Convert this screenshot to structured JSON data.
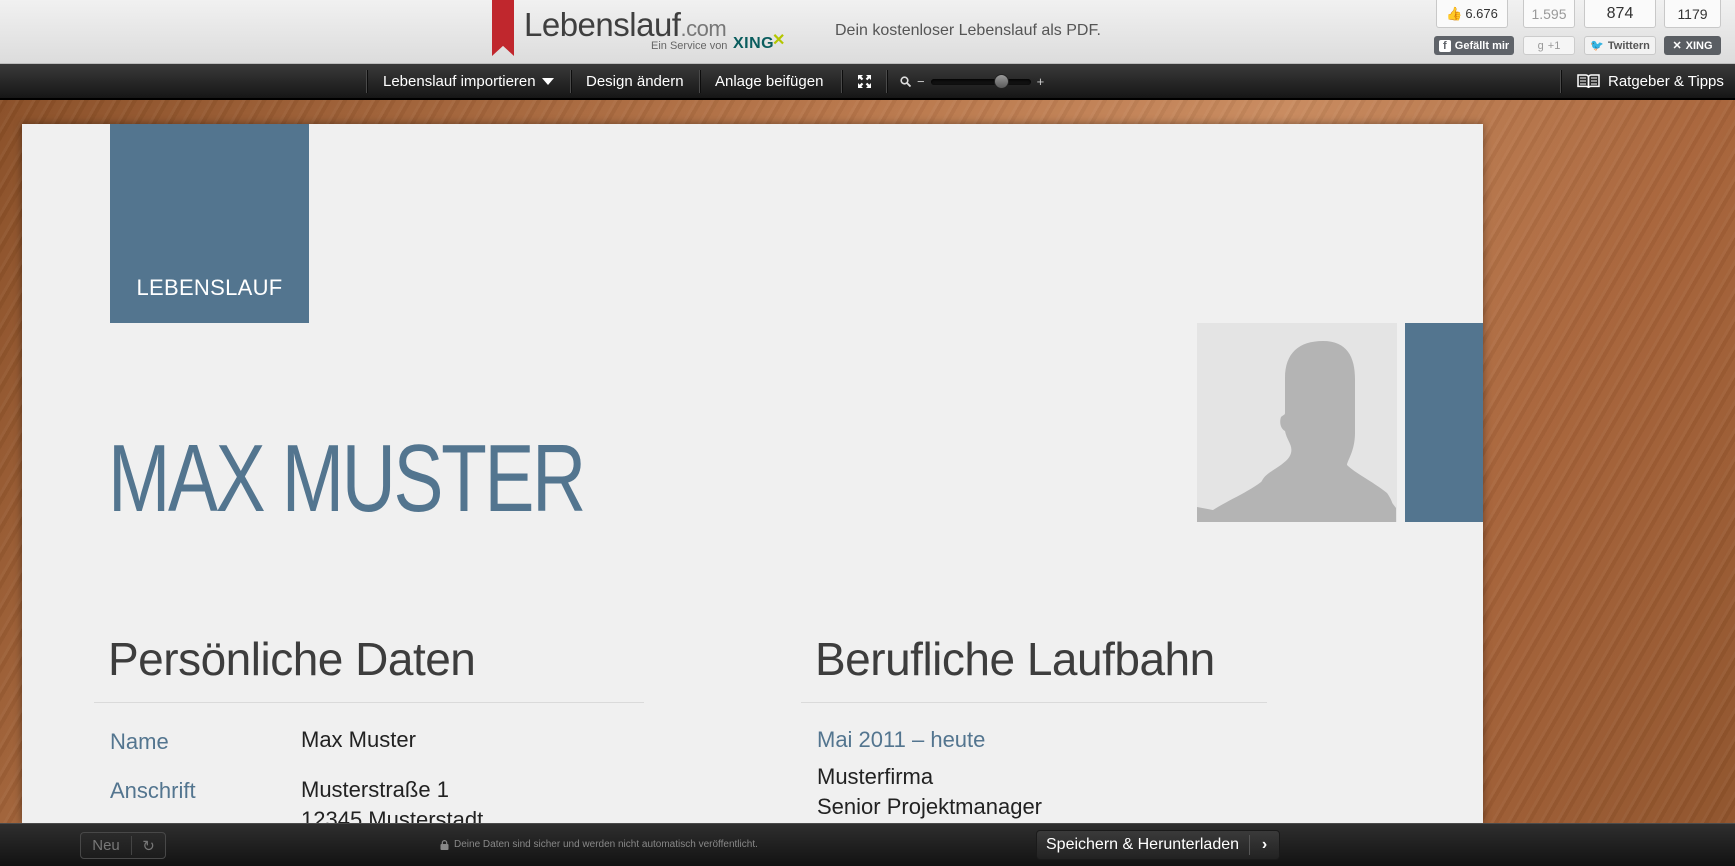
{
  "brand": {
    "logo_main": "Lebenslauf",
    "logo_tld": ".com",
    "service_text": "Ein Service von",
    "service_brand": "XING",
    "tagline": "Dein kostenloser Lebenslauf als PDF."
  },
  "social": {
    "facebook": {
      "count": "6.676",
      "label": "Gefällt mir"
    },
    "googleplus": {
      "count": "1.595",
      "label": "+1"
    },
    "twitter": {
      "count": "874",
      "label": "Twittern"
    },
    "xing": {
      "count": "1179",
      "label": "XING"
    }
  },
  "nav": {
    "import_label": "Lebenslauf importieren",
    "design_label": "Design ändern",
    "attachment_label": "Anlage beifügen",
    "zoom_minus": "−",
    "zoom_plus": "+",
    "zoom_level": 0.75,
    "guide_label": "Ratgeber & Tipps"
  },
  "cv": {
    "badge": "LEBENSLAUF",
    "name": "MAX MUSTER",
    "personal": {
      "title": "Persönliche Daten",
      "rows": [
        {
          "label": "Name",
          "value": [
            "Max Muster"
          ]
        },
        {
          "label": "Anschrift",
          "value": [
            "Musterstraße 1",
            "12345 Musterstadt"
          ]
        }
      ]
    },
    "career": {
      "title": "Berufliche Laufbahn",
      "entries": [
        {
          "period": "Mai 2011 – heute",
          "company": "Musterfirma",
          "role": "Senior Projektmanager"
        }
      ]
    }
  },
  "footer": {
    "new_label": "Neu",
    "privacy_text": "Deine Daten sind sicher und werden nicht automatisch veröffentlicht.",
    "save_label": "Speichern & Herunterladen"
  },
  "colors": {
    "accent": "#53758f",
    "wood": "#b8764a",
    "ribbon": "#c0272d"
  }
}
